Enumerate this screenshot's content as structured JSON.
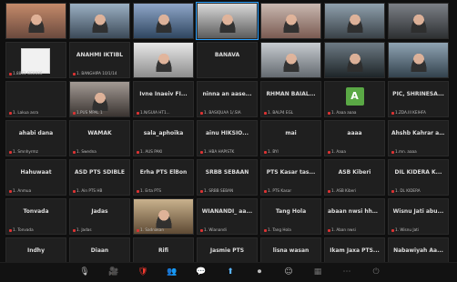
{
  "app": {
    "toolbar": {
      "buttons": [
        {
          "icon": "mute-icon"
        },
        {
          "icon": "video-icon"
        },
        {
          "icon": "security-icon"
        },
        {
          "icon": "participants-icon"
        },
        {
          "icon": "chat-icon"
        },
        {
          "icon": "share-screen-icon"
        },
        {
          "icon": "record-icon"
        },
        {
          "icon": "reactions-icon"
        },
        {
          "icon": "apps-icon"
        },
        {
          "icon": "more-icon"
        },
        {
          "icon": "leave-icon"
        }
      ]
    }
  },
  "tiles": [
    {
      "kind": "video",
      "style": "v1",
      "center": "",
      "name": ""
    },
    {
      "kind": "video",
      "style": "v2",
      "center": "",
      "name": ""
    },
    {
      "kind": "video",
      "style": "v3",
      "center": "",
      "name": ""
    },
    {
      "kind": "video",
      "style": "v4",
      "center": "",
      "name": ""
    },
    {
      "kind": "video",
      "style": "v5",
      "center": "",
      "name": ""
    },
    {
      "kind": "video",
      "style": "v6",
      "center": "",
      "name": ""
    },
    {
      "kind": "video",
      "style": "v7",
      "center": "",
      "name": ""
    },
    {
      "kind": "paper",
      "style": "",
      "center": "",
      "name": "1.8851 OE0006"
    },
    {
      "kind": "text",
      "style": "",
      "center": "ANAHMI IKTIBL",
      "name": "1. BANGHIPA 10/1/14"
    },
    {
      "kind": "video",
      "style": "v8",
      "center": "",
      "name": ""
    },
    {
      "kind": "text",
      "style": "",
      "center": "BANAVA",
      "name": ""
    },
    {
      "kind": "video",
      "style": "v9",
      "center": "",
      "name": ""
    },
    {
      "kind": "video",
      "style": "v10",
      "center": "",
      "name": ""
    },
    {
      "kind": "video",
      "style": "v11",
      "center": "",
      "name": ""
    },
    {
      "kind": "text",
      "style": "",
      "center": "",
      "name": "1. Lakua asra"
    },
    {
      "kind": "video",
      "style": "v12",
      "center": "",
      "name": "1.PUS MPAL 1"
    },
    {
      "kind": "text",
      "style": "",
      "center": "Ivne Inaeiv FI...",
      "name": "1.N/GUIA HT1..."
    },
    {
      "kind": "text",
      "style": "",
      "center": "ninna an aase...",
      "name": "1. BASIQUAA 1/.SIA"
    },
    {
      "kind": "text",
      "style": "",
      "center": "RHMAN BAIAL...",
      "name": "1. BALP4 EGL"
    },
    {
      "kind": "avatar",
      "style": "",
      "center": "A",
      "name": "1. Aaaa aaaa"
    },
    {
      "kind": "text",
      "style": "",
      "center": "PIC, SHRINESA...",
      "name": "1.ZDA.III KEIHFA"
    },
    {
      "kind": "text",
      "style": "",
      "center": "ahabi dana",
      "name": "1. Smnhyrmz"
    },
    {
      "kind": "text",
      "style": "",
      "center": "WAMAK",
      "name": "1. Swedna"
    },
    {
      "kind": "text",
      "style": "",
      "center": "sala_aphoika",
      "name": "1. AUS PAKI"
    },
    {
      "kind": "text",
      "style": "",
      "center": "ainu HIKSIO...",
      "name": "1. HBA HAPISTK"
    },
    {
      "kind": "text",
      "style": "",
      "center": "mai",
      "name": "1. BYI"
    },
    {
      "kind": "text",
      "style": "",
      "center": "aaaa",
      "name": "1. Aaaa"
    },
    {
      "kind": "text",
      "style": "",
      "center": "Ahshb Kahrar ao...",
      "name": "1.mn. aaaa"
    },
    {
      "kind": "text",
      "style": "",
      "center": "Hahuwaat",
      "name": "1. Anmua"
    },
    {
      "kind": "text",
      "style": "",
      "center": "ASD PTS SDIBLE",
      "name": "1. Ain PTS HB"
    },
    {
      "kind": "text",
      "style": "",
      "center": "Erha PTS ElBon",
      "name": "1. Erta PTS"
    },
    {
      "kind": "text",
      "style": "",
      "center": "SRBB SEBAAN",
      "name": "1. SRBB SEBAN"
    },
    {
      "kind": "text",
      "style": "",
      "center": "PTS Kasar tas...",
      "name": "1. PTS Kasar"
    },
    {
      "kind": "text",
      "style": "",
      "center": "ASB Kiberi",
      "name": "1. ASB Kiberi"
    },
    {
      "kind": "text",
      "style": "",
      "center": "DIL KIDERA K...",
      "name": "1. DL KIDERA"
    },
    {
      "kind": "text",
      "style": "",
      "center": "Tonvada",
      "name": "1. Tonvada"
    },
    {
      "kind": "text",
      "style": "",
      "center": "Jadas",
      "name": "1. Jadas"
    },
    {
      "kind": "video",
      "style": "v13",
      "center": "",
      "name": "1. Sadnakan"
    },
    {
      "kind": "text",
      "style": "",
      "center": "WIANANDI_ aa...",
      "name": "1. Wianandi"
    },
    {
      "kind": "text",
      "style": "",
      "center": "Tang Hola",
      "name": "1. Tang Hola"
    },
    {
      "kind": "text",
      "style": "",
      "center": "abaan nwsi hhb...",
      "name": "1. Aban nwsi"
    },
    {
      "kind": "text",
      "style": "",
      "center": "Wisnu Jati abu...",
      "name": "1. Wisnu Jati"
    },
    {
      "kind": "text",
      "style": "",
      "center": "Indhy",
      "name": "1. Indhy"
    },
    {
      "kind": "text",
      "style": "",
      "center": "Diaan",
      "name": "1. Diaan"
    },
    {
      "kind": "text",
      "style": "",
      "center": "Rifi",
      "name": "1. Rifi"
    },
    {
      "kind": "text",
      "style": "",
      "center": "Jasmie PTS",
      "name": "1. Jasmie PTS"
    },
    {
      "kind": "text",
      "style": "",
      "center": "lisna wasan",
      "name": "1. lisna wasan"
    },
    {
      "kind": "text",
      "style": "",
      "center": "Ikam Jaxa PTS...",
      "name": "1. Ikam Jaxa"
    },
    {
      "kind": "text",
      "style": "",
      "center": "Nabawiyah Aa...",
      "name": "1. Nabawiyah"
    }
  ]
}
